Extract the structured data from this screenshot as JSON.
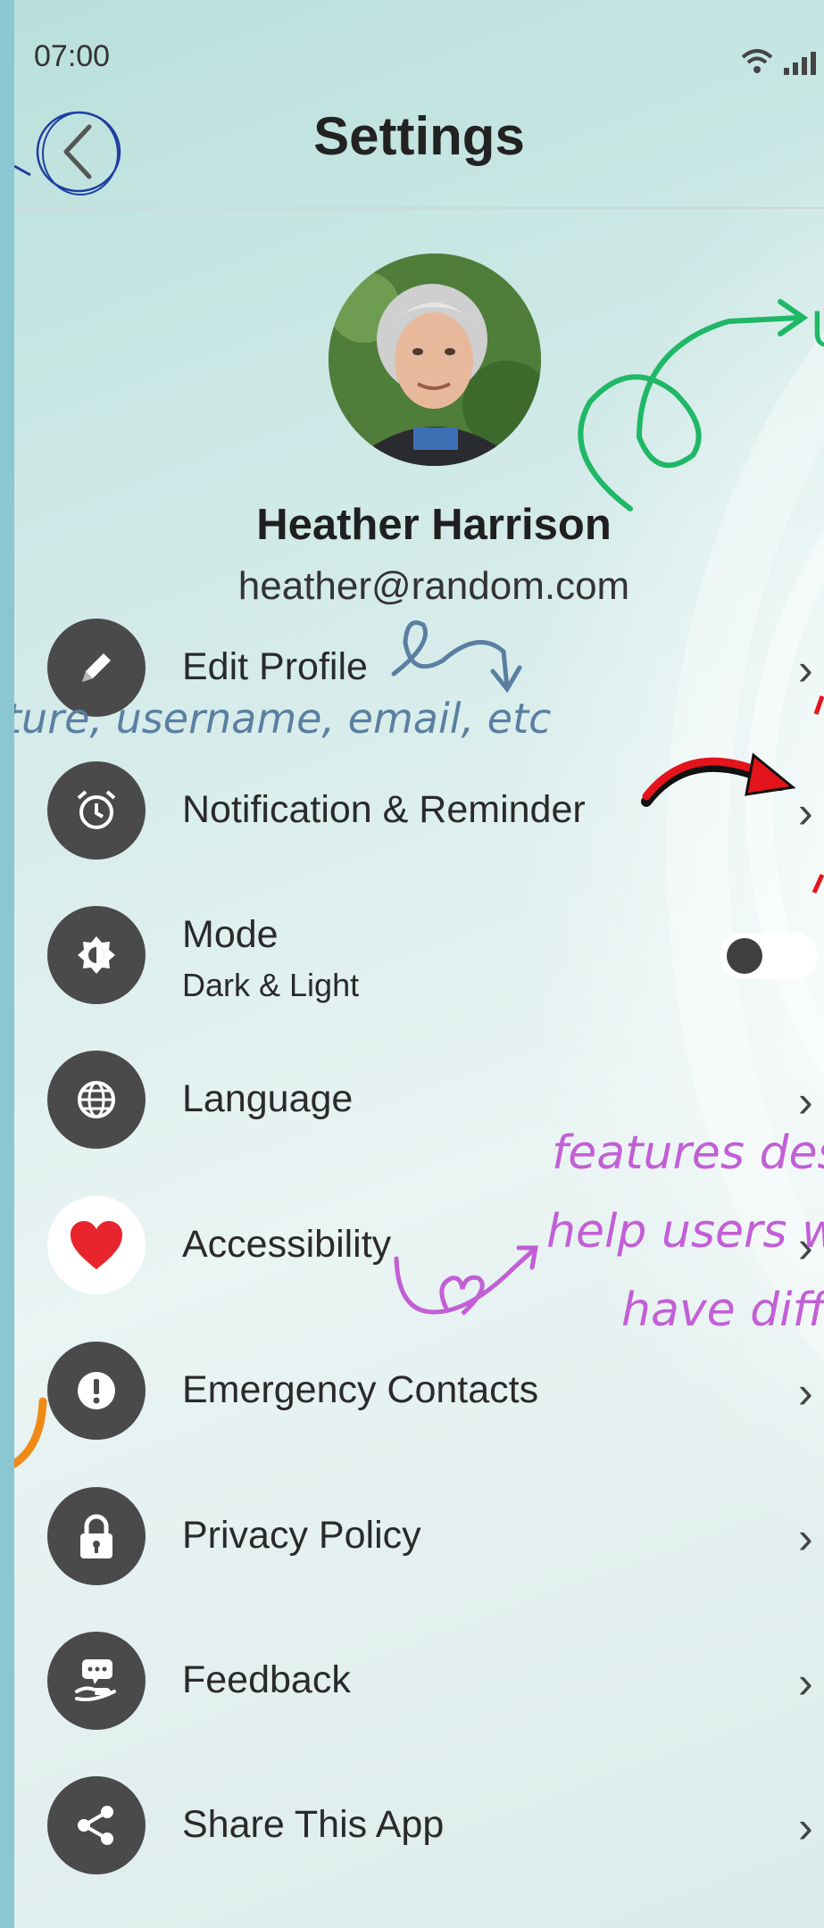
{
  "status_bar": {
    "time": "07:00"
  },
  "header": {
    "title": "Settings"
  },
  "profile": {
    "name": "Heather Harrison",
    "email": "heather@random.com"
  },
  "menu": [
    {
      "label": "Edit Profile",
      "icon": "pencil-icon",
      "control": "chevron"
    },
    {
      "label": "Notification & Reminder",
      "icon": "alarm-clock-icon",
      "control": "chevron"
    },
    {
      "label": "Mode",
      "sublabel": "Dark & Light",
      "icon": "brightness-icon",
      "control": "toggle",
      "toggle_on": false
    },
    {
      "label": "Language",
      "icon": "globe-icon",
      "control": "chevron"
    },
    {
      "label": "Accessibility",
      "icon": "heart-icon",
      "control": "chevron"
    },
    {
      "label": "Emergency Contacts",
      "icon": "alert-icon",
      "control": "chevron"
    },
    {
      "label": "Privacy Policy",
      "icon": "lock-icon",
      "control": "chevron"
    },
    {
      "label": "Feedback",
      "icon": "feedback-hand-icon",
      "control": "chevron"
    },
    {
      "label": "Share This App",
      "icon": "share-icon",
      "control": "chevron"
    }
  ],
  "annotations": {
    "edit_profile_note": "ture, username, email, etc",
    "accessibility_note_line1": "features desi",
    "accessibility_note_line2": "help users w",
    "accessibility_note_line3": "have diffi",
    "green_note": "U"
  },
  "colors": {
    "icon_circle": "#4a4a4a",
    "heart": "#e8242c",
    "annotation_blue": "#5a7fa1",
    "annotation_purple": "#c25fd6",
    "annotation_green": "#1fb866",
    "annotation_red": "#e3141b"
  }
}
